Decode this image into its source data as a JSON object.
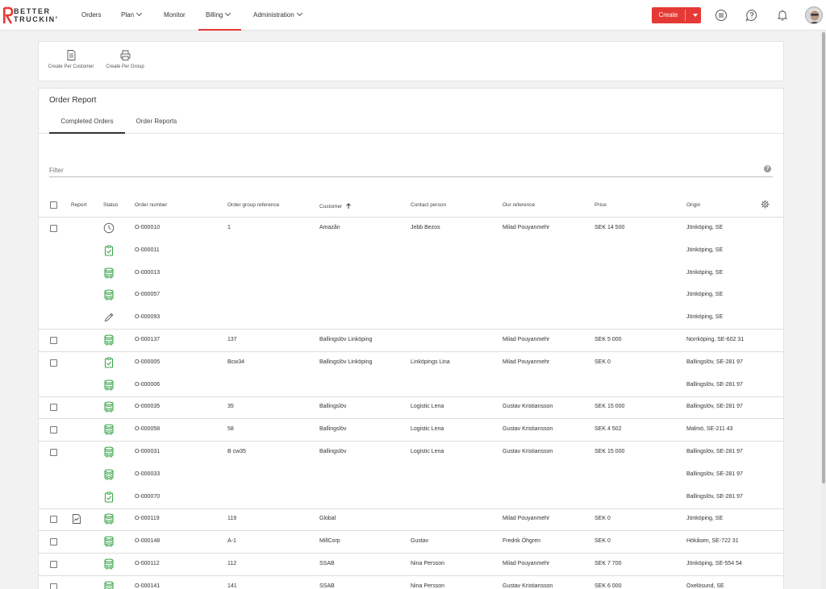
{
  "brand": {
    "line1": "BETTER",
    "line2": "TRUCKIN'",
    "accent": "#e53935"
  },
  "nav": {
    "items": [
      {
        "label": "Orders",
        "dropdown": false
      },
      {
        "label": "Plan",
        "dropdown": true
      },
      {
        "label": "Monitor",
        "dropdown": false
      },
      {
        "label": "Billing",
        "dropdown": true,
        "active": true
      },
      {
        "label": "Administration",
        "dropdown": true
      }
    ],
    "create_label": "Create",
    "icons": [
      "list-icon",
      "help-icon",
      "bell-icon",
      "avatar"
    ]
  },
  "actions": {
    "per_customer": "Create Per Customer",
    "per_group": "Create Per Group"
  },
  "report": {
    "title": "Order Report",
    "tabs": [
      "Completed Orders",
      "Order Reports"
    ],
    "filter_placeholder": "Filter",
    "help_glyph": "?"
  },
  "table": {
    "headers": {
      "report": "Report",
      "status": "Status",
      "order_number": "Order number",
      "group_ref": "Order group reference",
      "customer": "Customer",
      "contact": "Contact person",
      "our_ref": "Our reference",
      "price": "Price",
      "origin": "Origin"
    },
    "sort_column": "customer",
    "sort_direction": "ascending",
    "rows": [
      {
        "checkbox": true,
        "report_icon": false,
        "status": "clock",
        "order": "O-000010",
        "group": "1",
        "customer": "Amazån",
        "contact": "Jebb Bezos",
        "ourref": "Milad Pouyanmehr",
        "price": "SEK 14 500",
        "origin": "Jönköping, SE",
        "group_end": false
      },
      {
        "checkbox": false,
        "report_icon": false,
        "status": "clipboard",
        "order": "O-000011",
        "group": "",
        "customer": "",
        "contact": "",
        "ourref": "",
        "price": "",
        "origin": "Jönköping, SE",
        "group_end": false
      },
      {
        "checkbox": false,
        "report_icon": false,
        "status": "truck-db",
        "order": "O-000013",
        "group": "",
        "customer": "",
        "contact": "",
        "ourref": "",
        "price": "",
        "origin": "Jönköping, SE",
        "group_end": false
      },
      {
        "checkbox": false,
        "report_icon": false,
        "status": "truck-db",
        "order": "O-000057",
        "group": "",
        "customer": "",
        "contact": "",
        "ourref": "",
        "price": "",
        "origin": "Jönköping, SE",
        "group_end": false
      },
      {
        "checkbox": false,
        "report_icon": false,
        "status": "pencil",
        "order": "O-000093",
        "group": "",
        "customer": "",
        "contact": "",
        "ourref": "",
        "price": "",
        "origin": "Jönköping, SE",
        "group_end": true
      },
      {
        "checkbox": true,
        "report_icon": false,
        "status": "truck-db",
        "order": "O-000137",
        "group": "137",
        "customer": "Ballingslöv Linköping",
        "contact": "",
        "ourref": "Milad Pouyanmehr",
        "price": "SEK 5 000",
        "origin": "Norrköping, SE-602 31",
        "group_end": true
      },
      {
        "checkbox": true,
        "report_icon": false,
        "status": "clipboard",
        "order": "O-000005",
        "group": "Bcw34",
        "customer": "Ballingslöv Linköping",
        "contact": "Linköpings Lina",
        "ourref": "Milad Pouyanmehr",
        "price": "SEK 0",
        "origin": "Ballingslöv, SE-281 97",
        "group_end": false
      },
      {
        "checkbox": false,
        "report_icon": false,
        "status": "truck-db",
        "order": "O-000006",
        "group": "",
        "customer": "",
        "contact": "",
        "ourref": "",
        "price": "",
        "origin": "Ballingslöv, SE-281 97",
        "group_end": true
      },
      {
        "checkbox": true,
        "report_icon": false,
        "status": "truck-db",
        "order": "O-000035",
        "group": "35",
        "customer": "Ballingslöv",
        "contact": "Logistic Lena",
        "ourref": "Gustav Kristiansson",
        "price": "SEK 15 000",
        "origin": "Ballingslöv, SE-281 97",
        "group_end": true
      },
      {
        "checkbox": true,
        "report_icon": false,
        "status": "truck-db",
        "order": "O-000058",
        "group": "58",
        "customer": "Ballingslöv",
        "contact": "Logistic Lena",
        "ourref": "Gustav Kristiansson",
        "price": "SEK 4 502",
        "origin": "Malmö, SE-211 43",
        "group_end": true
      },
      {
        "checkbox": true,
        "report_icon": false,
        "status": "truck-db",
        "order": "O-000031",
        "group": "B cw35",
        "customer": "Ballingslöv",
        "contact": "Logistic Lena",
        "ourref": "Gustav Kristiansson",
        "price": "SEK 15 000",
        "origin": "Ballingslöv, SE-281 97",
        "group_end": false
      },
      {
        "checkbox": false,
        "report_icon": false,
        "status": "truck-db",
        "order": "O-000033",
        "group": "",
        "customer": "",
        "contact": "",
        "ourref": "",
        "price": "",
        "origin": "Ballingslöv, SE-281 97",
        "group_end": false
      },
      {
        "checkbox": false,
        "report_icon": false,
        "status": "clipboard",
        "order": "O-000070",
        "group": "",
        "customer": "",
        "contact": "",
        "ourref": "",
        "price": "",
        "origin": "Ballingslöv, SE-281 97",
        "group_end": true
      },
      {
        "checkbox": true,
        "report_icon": true,
        "status": "truck-db",
        "order": "O-000119",
        "group": "119",
        "customer": "Global",
        "contact": "",
        "ourref": "Milad Pouyanmehr",
        "price": "SEK 0",
        "origin": "Jönköping, SE",
        "group_end": true
      },
      {
        "checkbox": true,
        "report_icon": false,
        "status": "truck-db",
        "order": "O-000148",
        "group": "A-1",
        "customer": "MillCorp",
        "contact": "Gustav",
        "ourref": "Fredrik Öhgren",
        "price": "SEK 0",
        "origin": "Hökåsen, SE-722 31",
        "group_end": true
      },
      {
        "checkbox": true,
        "report_icon": false,
        "status": "truck-db",
        "order": "O-000112",
        "group": "112",
        "customer": "SSAB",
        "contact": "Nina Persson",
        "ourref": "Milad Pouyanmehr",
        "price": "SEK 7 700",
        "origin": "Jönköping, SE-554 54",
        "group_end": true
      },
      {
        "checkbox": true,
        "report_icon": false,
        "status": "truck-db",
        "order": "O-000141",
        "group": "141",
        "customer": "SSAB",
        "contact": "Nina Persson",
        "ourref": "Gustav Kristiansson",
        "price": "SEK 6 000",
        "origin": "Oxelösund, SE",
        "group_end": true
      }
    ]
  },
  "colors": {
    "status_green": "#3aa64a",
    "status_gray": "#666666",
    "checkbox_border": "#777777"
  }
}
